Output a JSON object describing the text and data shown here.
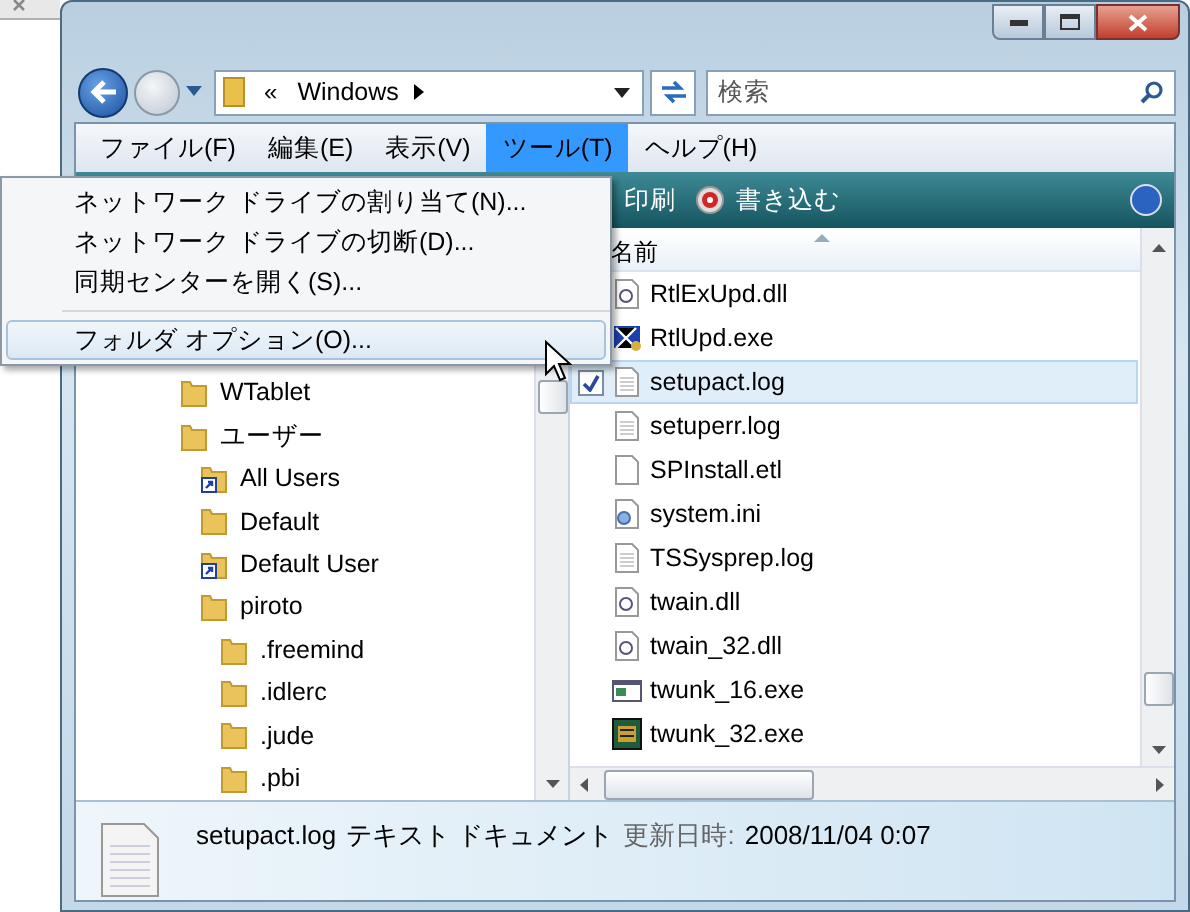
{
  "address_bar": {
    "chevron": "«",
    "location": "Windows"
  },
  "search": {
    "placeholder": "検索"
  },
  "menu_bar": [
    {
      "label": "ファイル(F)",
      "selected": false
    },
    {
      "label": "編集(E)",
      "selected": false
    },
    {
      "label": "表示(V)",
      "selected": false
    },
    {
      "label": "ツール(T)",
      "selected": true
    },
    {
      "label": "ヘルプ(H)",
      "selected": false
    }
  ],
  "toolbar": [
    {
      "label": "印刷",
      "kind": "plain"
    },
    {
      "label": "書き込む",
      "kind": "burn"
    }
  ],
  "tools_menu": [
    {
      "label": "ネットワーク ドライブの割り当て(N)...",
      "highlighted": false
    },
    {
      "label": "ネットワーク ドライブの切断(D)...",
      "highlighted": false
    },
    {
      "label": "同期センターを開く(S)...",
      "highlighted": false
    },
    {
      "kind": "separator"
    },
    {
      "label": "フォルダ オプション(O)...",
      "highlighted": true
    }
  ],
  "folder_tree": [
    {
      "label": "WTablet",
      "kind": "folder"
    },
    {
      "label": "ユーザー",
      "kind": "folder",
      "children": [
        {
          "label": "All Users",
          "kind": "shortcut"
        },
        {
          "label": "Default",
          "kind": "folder"
        },
        {
          "label": "Default User",
          "kind": "shortcut"
        },
        {
          "label": "piroto",
          "kind": "folder",
          "children": [
            {
              "label": ".freemind",
              "kind": "folder"
            },
            {
              "label": ".idlerc",
              "kind": "folder"
            },
            {
              "label": ".jude",
              "kind": "folder"
            },
            {
              "label": ".pbi",
              "kind": "folder"
            }
          ]
        }
      ]
    }
  ],
  "file_list": {
    "column": "名前",
    "rows": [
      {
        "name": "RtlExUpd.dll",
        "kind": "dll",
        "selected": false
      },
      {
        "name": "RtlUpd.exe",
        "kind": "setup",
        "selected": false
      },
      {
        "name": "setupact.log",
        "kind": "text",
        "selected": true,
        "checked": true
      },
      {
        "name": "setuperr.log",
        "kind": "text",
        "selected": false
      },
      {
        "name": "SPInstall.etl",
        "kind": "blank",
        "selected": false
      },
      {
        "name": "system.ini",
        "kind": "ini",
        "selected": false
      },
      {
        "name": "TSSysprep.log",
        "kind": "text",
        "selected": false
      },
      {
        "name": "twain.dll",
        "kind": "dll",
        "selected": false
      },
      {
        "name": "twain_32.dll",
        "kind": "dll",
        "selected": false
      },
      {
        "name": "twunk_16.exe",
        "kind": "window",
        "selected": false
      },
      {
        "name": "twunk_32.exe",
        "kind": "scanner",
        "selected": false
      }
    ]
  },
  "details": {
    "name": "setupact.log",
    "type": "テキスト ドキュメント",
    "modified_label": "更新日時:",
    "modified": "2008/11/04 0:07"
  }
}
